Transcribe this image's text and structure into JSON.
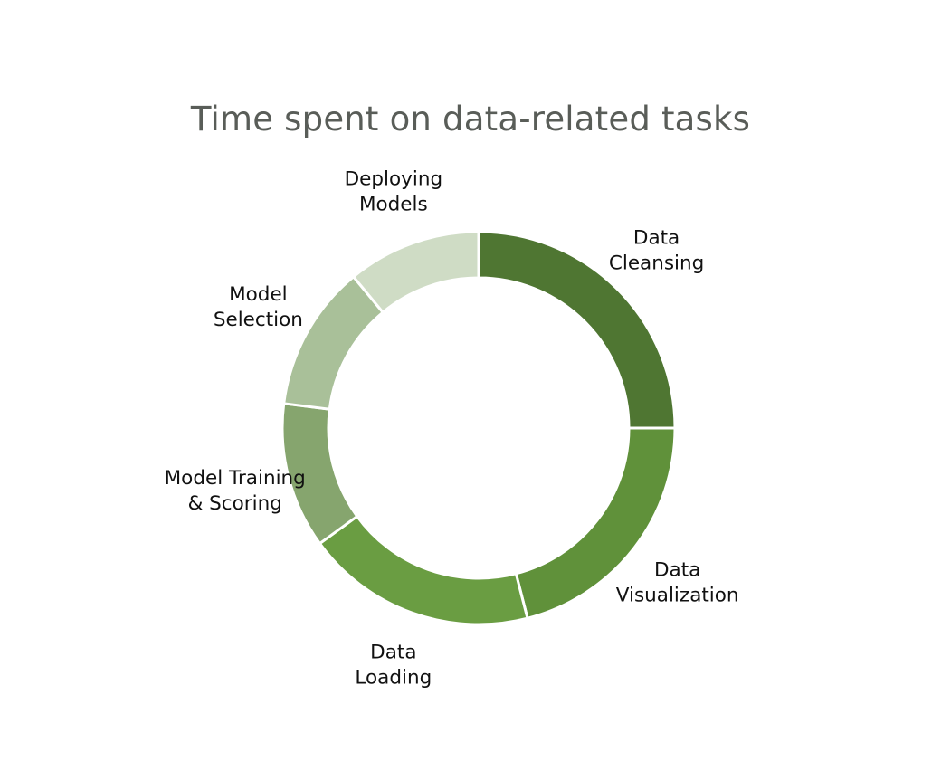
{
  "chart_data": {
    "type": "pie",
    "title": "Time spent on data-related tasks",
    "donut": true,
    "start_angle_deg": 0,
    "direction": "clockwise",
    "slices": [
      {
        "label": [
          "Data",
          "Cleansing"
        ],
        "value": 25,
        "color": "#4f7632"
      },
      {
        "label": [
          "Data",
          "Visualization"
        ],
        "value": 21,
        "color": "#60913a"
      },
      {
        "label": [
          "Data",
          "Loading"
        ],
        "value": 19,
        "color": "#6a9d42"
      },
      {
        "label": [
          "Model Training",
          "& Scoring"
        ],
        "value": 12,
        "color": "#86a56e"
      },
      {
        "label": [
          "Model",
          "Selection"
        ],
        "value": 12,
        "color": "#a9c099"
      },
      {
        "label": [
          "Deploying",
          "Models"
        ],
        "value": 11,
        "color": "#cfdcc5"
      }
    ]
  }
}
